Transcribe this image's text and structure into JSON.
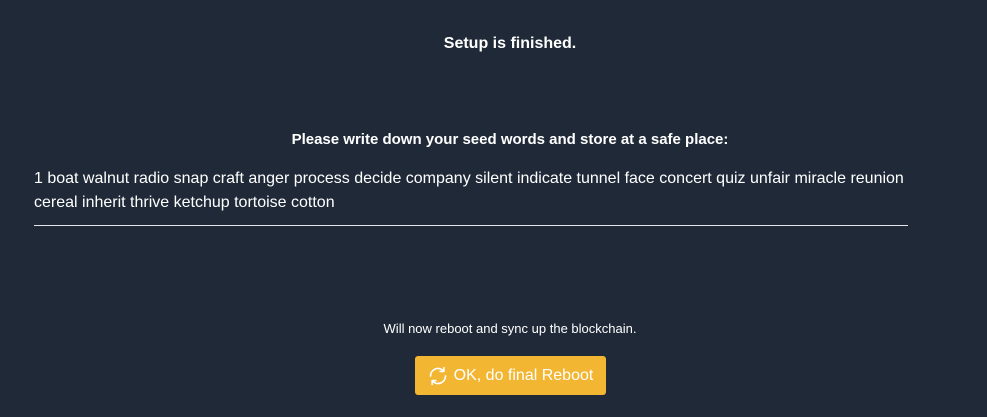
{
  "setup": {
    "title": "Setup is finished.",
    "instruction": "Please write down your seed words and store at a safe place:",
    "seed_words": "1 boat walnut radio snap craft anger process decide company silent indicate tunnel face concert quiz unfair miracle reunion cereal inherit thrive ketchup tortoise cotton",
    "reboot_note": "Will now reboot and sync up the blockchain.",
    "reboot_button_label": "OK, do final Reboot",
    "reboot_button_icon": "refresh-icon"
  },
  "colors": {
    "background": "#1f2937",
    "text": "#ffffff",
    "accent": "#f2b633",
    "divider": "#e5e7eb"
  }
}
